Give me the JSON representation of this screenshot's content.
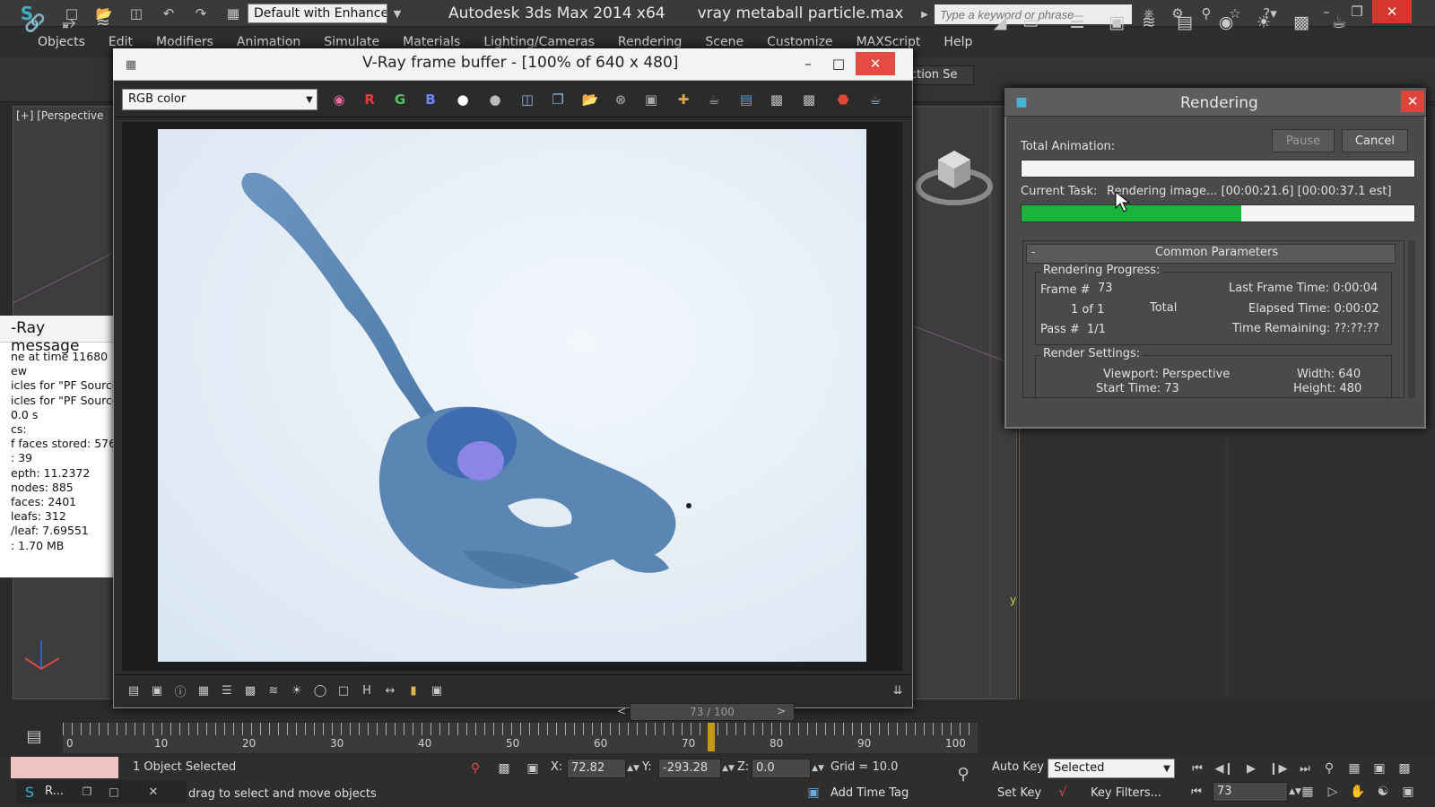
{
  "titlebar": {
    "workspace": "Default with Enhance",
    "app_name": "Autodesk 3ds Max  2014 x64",
    "file_name": "vray metaball particle.max",
    "search_placeholder": "Type a keyword or phrase"
  },
  "menubar": [
    "Objects",
    "Edit",
    "Modifiers",
    "Animation",
    "Simulate",
    "Materials",
    "Lighting/Cameras",
    "Rendering",
    "Scene",
    "Customize",
    "MAXScript",
    "Help"
  ],
  "toolbar": {
    "selection_set": "ction Se"
  },
  "viewport": {
    "label": "[+] [Perspective"
  },
  "vray_messages": {
    "title": "-Ray message",
    "lines": [
      "ne at time 11680",
      "ew",
      "icles for \"PF Source",
      "icles for \"PF Source",
      "0.0 s",
      "cs:",
      "f faces stored: 576",
      ": 39",
      "epth: 11.2372",
      "nodes: 885",
      "faces: 2401",
      "leafs: 312",
      "/leaf: 7.69551",
      ": 1.70 MB"
    ]
  },
  "frame_buffer": {
    "title": "V-Ray frame buffer - [100% of 640 x 480]",
    "channel": "RGB color",
    "r": "R",
    "g": "G",
    "b": "B"
  },
  "rendering_dialog": {
    "title": "Rendering",
    "pause": "Pause",
    "cancel": "Cancel",
    "total_animation_label": "Total Animation:",
    "total_progress": 0,
    "current_task_label": "Current Task:",
    "current_task_value": "Rendering image... [00:00:21.6] [00:00:37.1 est]",
    "current_progress": 0.56,
    "section_title": "Common Parameters",
    "section_toggle": "-",
    "progress_group": "Rendering Progress:",
    "frame_label": "Frame #",
    "frame_value": "73",
    "of_label": "1 of 1",
    "total_label": "Total",
    "pass_label": "Pass #",
    "pass_value": "1/1",
    "last_frame_time": "Last Frame Time:  0:00:04",
    "elapsed_time": "Elapsed Time:  0:00:02",
    "time_remaining": "Time Remaining:  ??:??:??",
    "settings_group": "Render Settings:",
    "viewport": "Viewport: Perspective",
    "width": "Width: 640",
    "start_time": "Start Time: 73",
    "height": "Height: 480"
  },
  "timeline": {
    "slider_text": "73 / 100",
    "prev": "<",
    "next": ">",
    "current_frame": 73,
    "max_frame": 100,
    "ticks": [
      "0",
      "10",
      "20",
      "30",
      "40",
      "50",
      "60",
      "70",
      "80",
      "90",
      "100"
    ]
  },
  "statusbar": {
    "selection": "1 Object Selected",
    "prompt": "drag to select and move objects",
    "x_label": "X:",
    "x_value": "72.82",
    "y_label": "Y:",
    "y_value": "-293.28",
    "z_label": "Z:",
    "z_value": "0.0",
    "grid": "Grid = 10.0",
    "add_time_tag": "Add Time Tag",
    "auto_key": "Auto Key",
    "set_key": "Set Key",
    "key_mode": "Selected",
    "key_filters": "Key Filters...",
    "frame": "73",
    "taskbar_app": "R..."
  },
  "colors": {
    "progress_green": "#1cb33a",
    "close_red": "#e0433b",
    "render_bg": "#e4edf6",
    "blob_blue": "#5b86b3"
  }
}
